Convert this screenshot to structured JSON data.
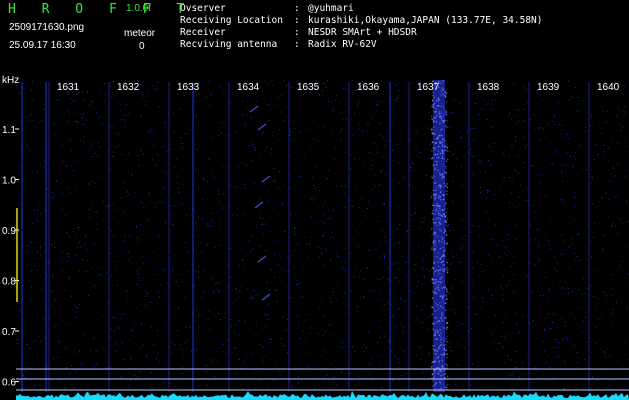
{
  "header": {
    "brand": "H R O F F T",
    "version": "1.0.0f",
    "filename": "2509171630.png",
    "datetime": "25.09.17 16:30",
    "meteor_label": "meteor",
    "meteor_count": "0"
  },
  "info": [
    {
      "key": "Ovserver",
      "sep": ":",
      "value": "@yuhmari"
    },
    {
      "key": "Receiving Location",
      "sep": ":",
      "value": "kurashiki,Okayama,JAPAN (133.77E, 34.58N)"
    },
    {
      "key": "Receiver",
      "sep": ":",
      "value": "NESDR SMArt + HDSDR"
    },
    {
      "key": "Recviving antenna",
      "sep": ":",
      "value": "Radix RV-62V"
    }
  ],
  "axes": {
    "y_unit": "kHz",
    "y_ticks": [
      "1.1",
      "1.0",
      "0.9",
      "0.8",
      "0.7",
      "0.6"
    ],
    "time_ticks": [
      "1631",
      "1632",
      "1633",
      "1634",
      "1635",
      "1636",
      "1637",
      "1638",
      "1639",
      "1640"
    ]
  },
  "colors": {
    "brand_green": "#39e639",
    "signal_blue": "#2a3cff",
    "noise_cyan": "#19d9ff",
    "grid_line": "#b9c6ff"
  }
}
